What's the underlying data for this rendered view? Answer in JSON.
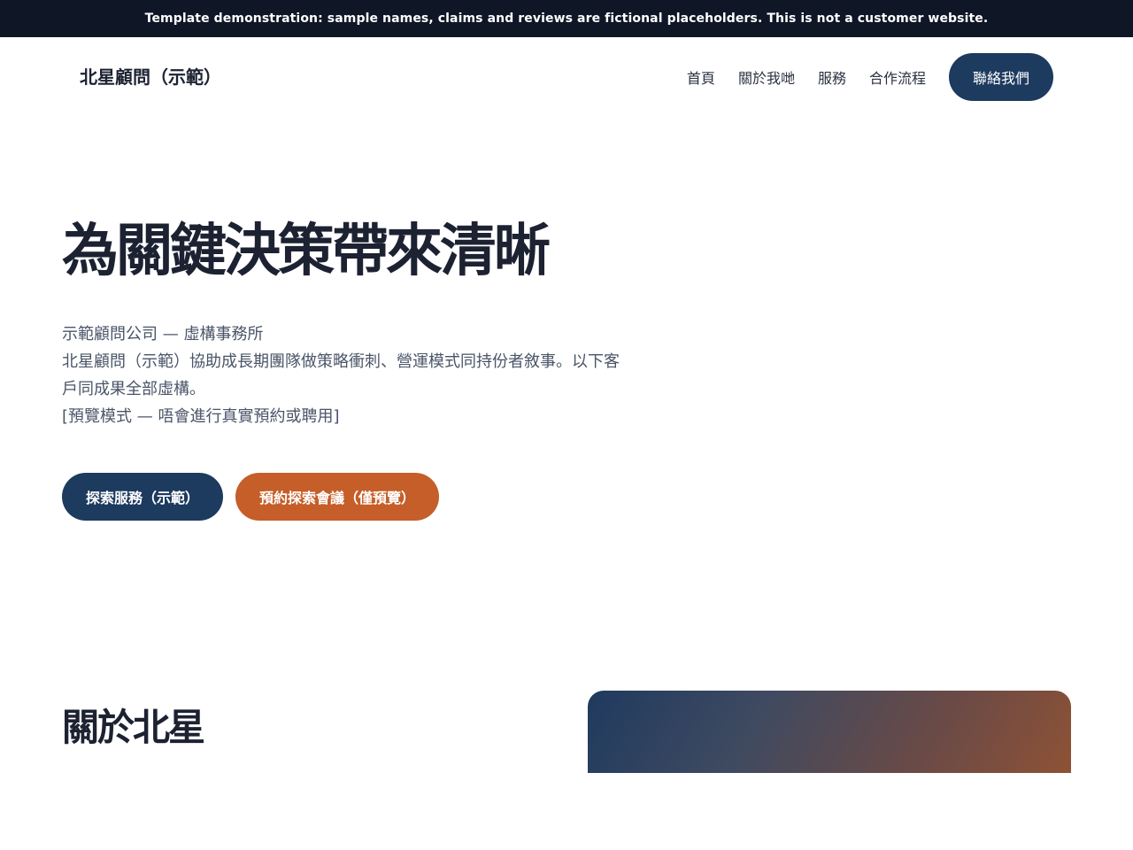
{
  "banner": {
    "text": "Template demonstration: sample names, claims and reviews are fictional placeholders. This is not a customer website."
  },
  "header": {
    "brand": "北星顧問（示範）",
    "nav": [
      "首頁",
      "關於我哋",
      "服務",
      "合作流程"
    ],
    "cta": "聯絡我們"
  },
  "hero": {
    "title": "為關鍵決策帶來清晰",
    "lines": [
      "示範顧問公司 — 虛構事務所",
      "北星顧問（示範）協助成長期團隊做策略衝刺、營運模式同持份者敘事。以下客",
      "戶同成果全部虛構。",
      "[預覽模式 — 唔會進行真實預約或聘用]"
    ],
    "primary_button": "探索服務（示範）",
    "secondary_button": "預約探索會議（僅預覽）"
  },
  "about": {
    "title": "關於北星"
  },
  "colors": {
    "navy": "#1d3a5f",
    "orange": "#c55e28",
    "banner_bg": "#0f1626"
  }
}
